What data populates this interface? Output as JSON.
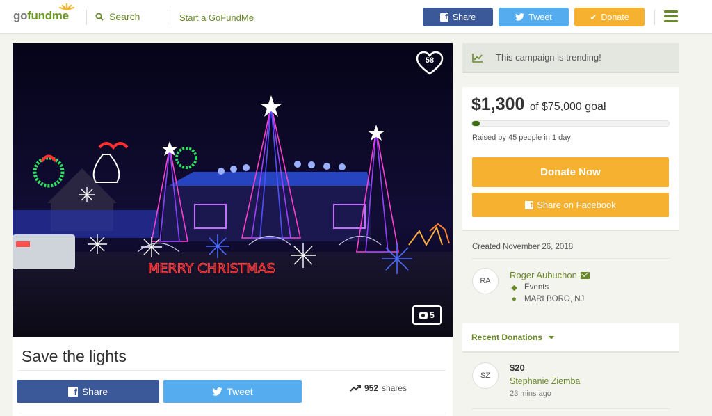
{
  "header": {
    "logo_part1": "go",
    "logo_part2": "fundme",
    "search_label": "Search",
    "start_label": "Start a GoFundMe",
    "share_label": "Share",
    "tweet_label": "Tweet",
    "donate_label": "Donate",
    "brand_color": "#6a9a1f",
    "facebook_color": "#3b5998",
    "twitter_color": "#55acee",
    "donate_color": "#f6b130"
  },
  "hero": {
    "likes": "58",
    "photo_count": "5",
    "sign_text": "MERRY CHRISTMAS"
  },
  "campaign": {
    "title": "Save the lights",
    "share_label": "Share",
    "tweet_label": "Tweet",
    "shares_count": "952",
    "shares_label": "shares"
  },
  "trending": {
    "text": "This campaign is trending!"
  },
  "donation": {
    "amount": "$1,300",
    "of": "of",
    "goal": "$75,000 goal",
    "progress_fraction": 0.017,
    "raised_text": "Raised by 45 people in 1 day",
    "donate_now": "Donate Now",
    "share_facebook": "Share on Facebook"
  },
  "organizer": {
    "created": "Created November 26, 2018",
    "initials": "RA",
    "name": "Roger Aubuchon",
    "category": "Events",
    "location": "MARLBORO, NJ"
  },
  "recent": {
    "label": "Recent Donations",
    "donations": [
      {
        "initials": "SZ",
        "amount": "$20",
        "name": "Stephanie Ziemba",
        "time": "23 mins ago"
      }
    ]
  }
}
